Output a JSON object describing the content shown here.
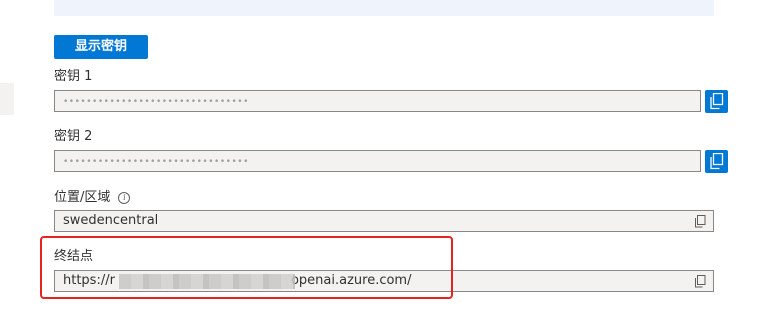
{
  "button": {
    "show_keys": "显示密钥"
  },
  "key1": {
    "label": "密钥 1",
    "value": "••••••••••••••••••••••••••••••••"
  },
  "key2": {
    "label": "密钥 2",
    "value": "••••••••••••••••••••••••••••••••"
  },
  "location": {
    "label": "位置/区域",
    "info_icon": "i",
    "value": "swedencentral"
  },
  "endpoint": {
    "label": "终结点",
    "value_prefix": "https://r",
    "value_suffix": "openai.azure.com/"
  },
  "colors": {
    "accent": "#0078d4",
    "highlight": "#e52323",
    "field_bg": "#f3f2f1"
  },
  "icons": [
    "copy-icon",
    "info-icon"
  ]
}
